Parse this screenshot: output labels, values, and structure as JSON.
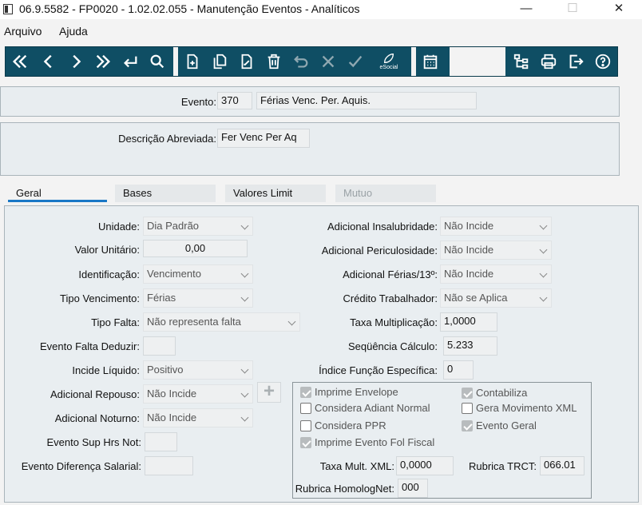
{
  "window": {
    "title": "06.9.5582 - FP0020 - 1.02.02.055 - Manutenção Eventos - Analíticos",
    "minimize": "—",
    "maximize": "☐",
    "close": "✕"
  },
  "menu": {
    "arquivo": "Arquivo",
    "ajuda": "Ajuda"
  },
  "toolbar": {
    "color": "#0f4e64",
    "buttons": [
      "first-icon",
      "previous-icon",
      "next-icon",
      "last-icon",
      "enter-icon",
      "search-icon",
      "new-icon",
      "copy-icon",
      "edit-icon",
      "delete-icon",
      "undo-icon",
      "cancel-icon",
      "confirm-icon",
      "esocial-icon",
      "calendar-icon",
      "tree-icon",
      "print-icon",
      "exit-icon",
      "help-icon"
    ],
    "esocial_label": "eSocial"
  },
  "header": {
    "evento_label": "Evento:",
    "evento_code": "370",
    "evento_desc": "Férias Venc. Per. Aquis.",
    "descricao_label": "Descrição Abreviada:",
    "descricao_value": "Fer Venc Per Aq"
  },
  "tabs": [
    {
      "label": "Geral",
      "active": true
    },
    {
      "label": "Bases",
      "active": false
    },
    {
      "label": "Valores Limit",
      "active": false
    },
    {
      "label": "Mutuo",
      "active": false,
      "disabled": true
    }
  ],
  "left": {
    "unidade_label": "Unidade:",
    "unidade_value": "Dia Padrão",
    "valor_label": "Valor Unitário:",
    "valor_value": "0,00",
    "ident_label": "Identificação:",
    "ident_value": "Vencimento",
    "tipovenc_label": "Tipo Vencimento:",
    "tipovenc_value": "Férias",
    "tipofalta_label": "Tipo Falta:",
    "tipofalta_value": "Não representa falta",
    "eventofalta_label": "Evento Falta Deduzir:",
    "eventofalta_value": "",
    "incide_label": "Incide Líquido:",
    "incide_value": "Positivo",
    "repouso_label": "Adicional Repouso:",
    "repouso_value": "Não Incide",
    "noturno_label": "Adicional Noturno:",
    "noturno_value": "Não Incide",
    "suphrs_label": "Evento Sup Hrs Not:",
    "suphrs_value": "",
    "difsal_label": "Evento Diferença Salarial:",
    "difsal_value": "",
    "plus": "+"
  },
  "right": {
    "insal_label": "Adicional Insalubridade:",
    "insal_value": "Não Incide",
    "peric_label": "Adicional Periculosidade:",
    "peric_value": "Não Incide",
    "ferias_label": "Adicional Férias/13º:",
    "ferias_value": "Não Incide",
    "credito_label": "Crédito Trabalhador:",
    "credito_value": "Não se Aplica",
    "taxa_label": "Taxa Multiplicação:",
    "taxa_value": "1,0000",
    "seq_label": "Seqüência Cálculo:",
    "seq_value": "5.233",
    "indice_label": "Índice Função Específica:",
    "indice_value": "0"
  },
  "checks": [
    {
      "label": "Imprime Envelope",
      "checked": true
    },
    {
      "label": "Contabiliza",
      "checked": true
    },
    {
      "label": "Considera Adiant Normal",
      "checked": false
    },
    {
      "label": "Gera Movimento XML",
      "checked": false
    },
    {
      "label": "Considera PPR",
      "checked": false
    },
    {
      "label": "Evento Geral",
      "checked": true
    },
    {
      "label": "Imprime Evento Fol Fiscal",
      "checked": true
    }
  ],
  "group": {
    "taxaxml_label": "Taxa Mult. XML:",
    "taxaxml_value": "0,0000",
    "trct_label": "Rubrica TRCT:",
    "trct_value": "066.01",
    "homolog_label": "Rubrica HomologNet:",
    "homolog_value": "000"
  }
}
